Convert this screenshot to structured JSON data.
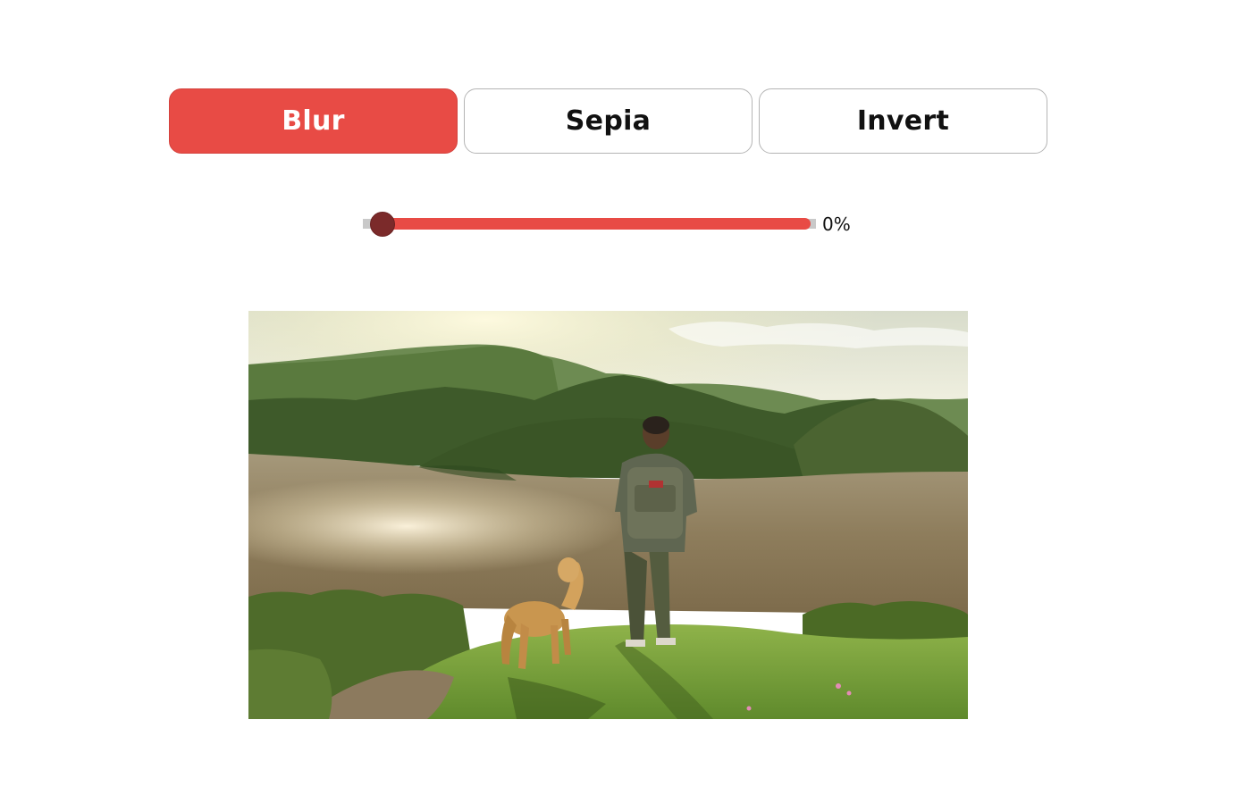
{
  "filters": {
    "tabs": [
      {
        "label": "Blur",
        "active": true
      },
      {
        "label": "Sepia",
        "active": false
      },
      {
        "label": "Invert",
        "active": false
      }
    ]
  },
  "slider": {
    "value_text": "0%",
    "value_percent": 0
  },
  "colors": {
    "accent": "#e84b45",
    "thumb": "#7b2a2a",
    "track": "#c9c9c9"
  },
  "image": {
    "alt": "Hiker with backpack and golden retriever overlooking a lake among green hills at sunset"
  }
}
